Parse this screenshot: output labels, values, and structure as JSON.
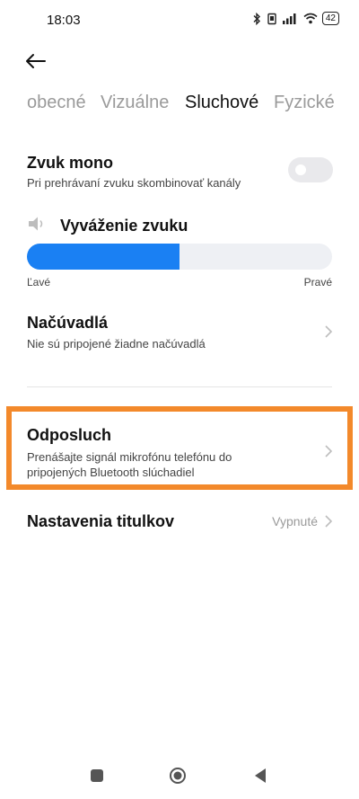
{
  "status_bar": {
    "time": "18:03",
    "battery": "42"
  },
  "tabs": [
    {
      "label": "obecné",
      "active": false
    },
    {
      "label": "Vizuálne",
      "active": false
    },
    {
      "label": "Sluchové",
      "active": true
    },
    {
      "label": "Fyzické",
      "active": false
    }
  ],
  "mono": {
    "title": "Zvuk mono",
    "subtitle": "Pri prehrávaní zvuku skombinovať kanály",
    "enabled": false
  },
  "balance": {
    "title": "Vyváženie zvuku",
    "left_label": "Ľavé",
    "right_label": "Pravé",
    "value_percent": 50
  },
  "hearing_aids": {
    "title": "Načúvadlá",
    "subtitle": "Nie sú pripojené žiadne načúvadlá"
  },
  "live_listen": {
    "title": "Odposluch",
    "subtitle_line1": "Prenášajte signál mikrofónu telefónu do",
    "subtitle_line2": "pripojených Bluetooth slúchadiel"
  },
  "captions": {
    "title": "Nastavenia titulkov",
    "value": "Vypnuté"
  },
  "colors": {
    "accent": "#1a80f3",
    "highlight": "#f3892b"
  }
}
